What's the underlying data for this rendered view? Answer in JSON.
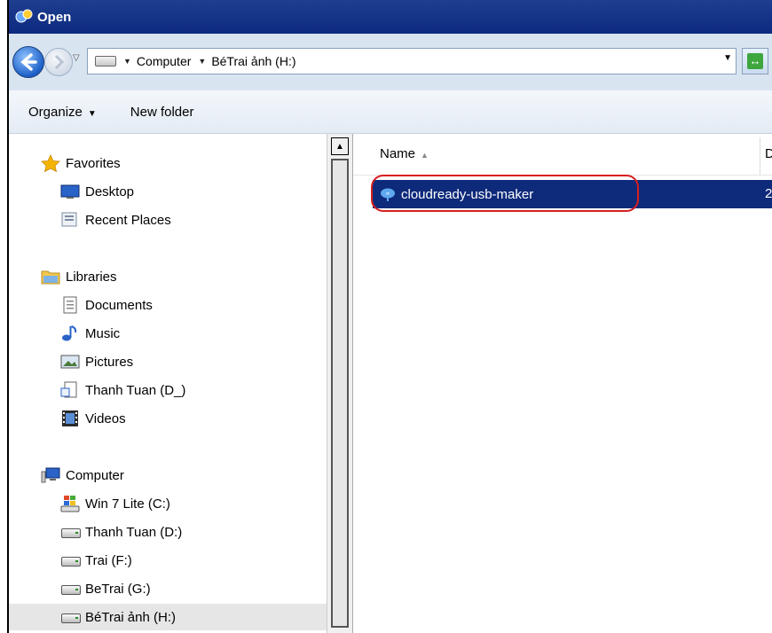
{
  "window": {
    "title": "Open"
  },
  "address": {
    "crumbs": [
      "Computer",
      "BéTrai ảnh (H:)"
    ]
  },
  "toolbar": {
    "organize": "Organize",
    "new_folder": "New folder"
  },
  "nav": {
    "favorites": {
      "label": "Favorites",
      "items": [
        "Desktop",
        "Recent Places"
      ]
    },
    "libraries": {
      "label": "Libraries",
      "items": [
        "Documents",
        "Music",
        "Pictures",
        "Thanh Tuan (D_)",
        "Videos"
      ]
    },
    "computer": {
      "label": "Computer",
      "items": [
        "Win 7 Lite (C:)",
        "Thanh Tuan (D:)",
        "Trai (F:)",
        "BeTrai (G:)",
        "BéTrai ảnh (H:)"
      ]
    }
  },
  "columns": {
    "name": "Name",
    "date_partial": "D"
  },
  "files": [
    {
      "name": "cloudready-usb-maker",
      "col2_partial": "2",
      "selected": true
    }
  ],
  "colors": {
    "titlebar": "#0c2a80",
    "selection": "#0e2a7a",
    "highlight_circle": "#d62020"
  }
}
